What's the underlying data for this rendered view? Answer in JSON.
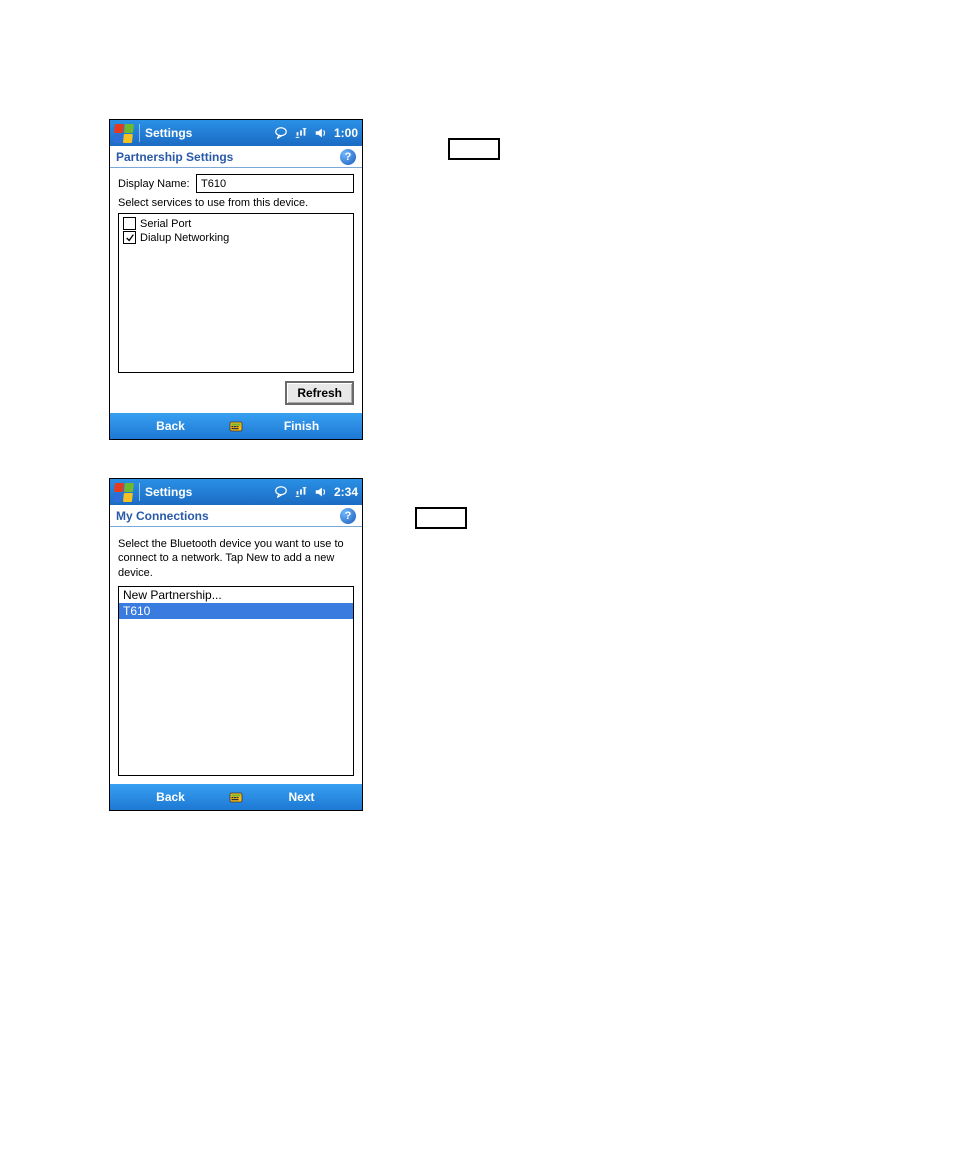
{
  "screen1": {
    "titlebar": {
      "app": "Settings",
      "time": "1:00"
    },
    "subheader": "Partnership Settings",
    "displayName": {
      "label": "Display Name:",
      "value": "T610"
    },
    "instruct": "Select services to use from this device.",
    "services": [
      {
        "label": "Serial Port",
        "checked": false
      },
      {
        "label": "Dialup Networking",
        "checked": true
      }
    ],
    "refreshLabel": "Refresh",
    "softkeys": {
      "left": "Back",
      "right": "Finish"
    }
  },
  "screen2": {
    "titlebar": {
      "app": "Settings",
      "time": "2:34"
    },
    "subheader": "My Connections",
    "instruct": "Select the Bluetooth device you want to use to connect to a network. Tap New to add a new device.",
    "list": {
      "new": "New Partnership...",
      "items": [
        {
          "label": "T610",
          "selected": true
        }
      ]
    },
    "softkeys": {
      "left": "Back",
      "right": "Next"
    }
  }
}
